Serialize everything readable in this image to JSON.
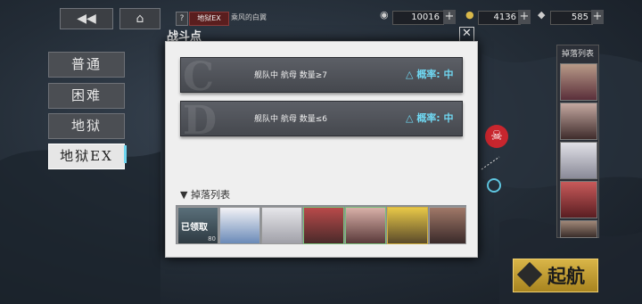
{
  "top": {
    "help": "?",
    "mode_tag": "地狱EX",
    "stage_name": "乘风的白翼",
    "oil": "10016",
    "gold": "4136",
    "gems": "585"
  },
  "difficulty": [
    "普通",
    "困难",
    "地狱",
    "地狱EX"
  ],
  "selected_difficulty": 3,
  "right_panel": {
    "title": "掉落列表"
  },
  "dialog": {
    "title": "战斗点",
    "conditions": [
      {
        "letter": "C",
        "text": "舰队中 航母 数量≥7",
        "prob_label": "概率: 中"
      },
      {
        "letter": "D",
        "text": "舰队中 航母 数量≤6",
        "prob_label": "概率: 中"
      }
    ],
    "drops_header": "掉落列表",
    "first_drop": {
      "badge": "已领取",
      "count": "80"
    }
  },
  "sortie": {
    "label": "起航"
  },
  "colors": {
    "accent_cyan": "#6fd6f0",
    "gold": "#d9b548",
    "marker_red": "#c8262e"
  }
}
